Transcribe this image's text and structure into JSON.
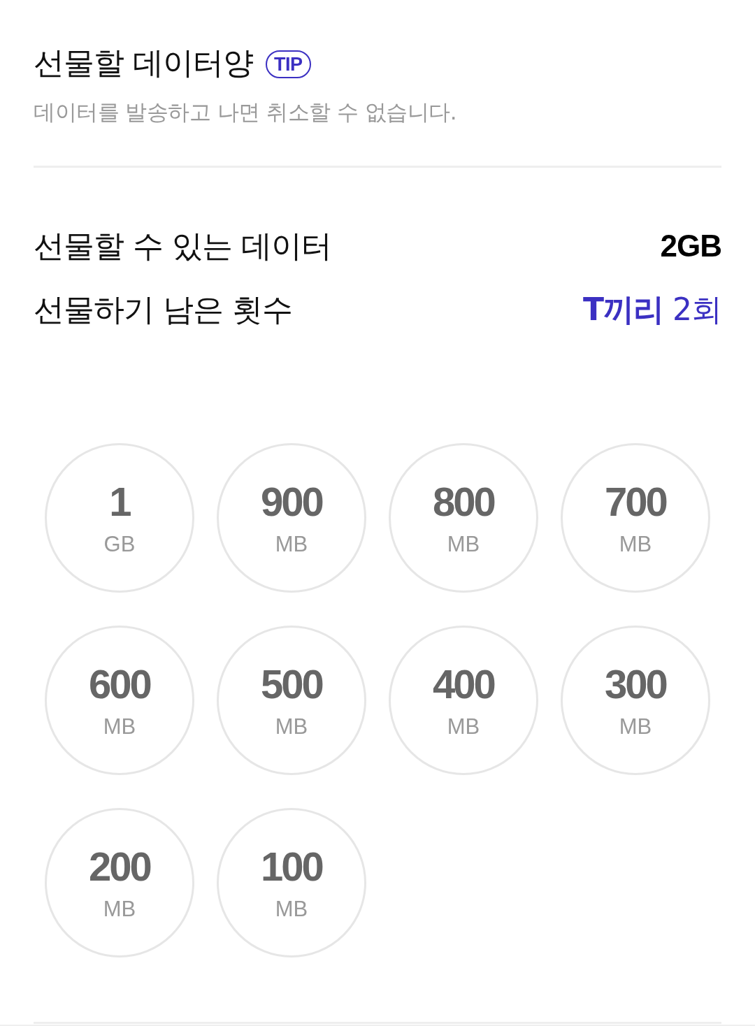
{
  "header": {
    "title": "선물할 데이터양",
    "tip_badge": "TIP",
    "notice": "데이터를 발송하고 나면 취소할 수 없습니다."
  },
  "summary": [
    {
      "kind": "amount",
      "label": "선물할 수 있는 데이터",
      "value": "2GB"
    },
    {
      "kind": "count",
      "label": "선물하기 남은 횟수",
      "value": "**T끼리** 2회"
    }
  ],
  "options": [
    {
      "amount": "1",
      "unit": "GB",
      "selected": false
    },
    {
      "amount": "900",
      "unit": "MB",
      "selected": false
    },
    {
      "amount": "800",
      "unit": "MB",
      "selected": false
    },
    {
      "amount": "700",
      "unit": "MB",
      "selected": false
    },
    {
      "amount": "600",
      "unit": "MB",
      "selected": false
    },
    {
      "amount": "500",
      "unit": "MB",
      "selected": false
    },
    {
      "amount": "400",
      "unit": "MB",
      "selected": false
    },
    {
      "amount": "300",
      "unit": "MB",
      "selected": false
    },
    {
      "amount": "200",
      "unit": "MB",
      "selected": false
    },
    {
      "amount": "100",
      "unit": "MB",
      "selected": false
    }
  ]
}
